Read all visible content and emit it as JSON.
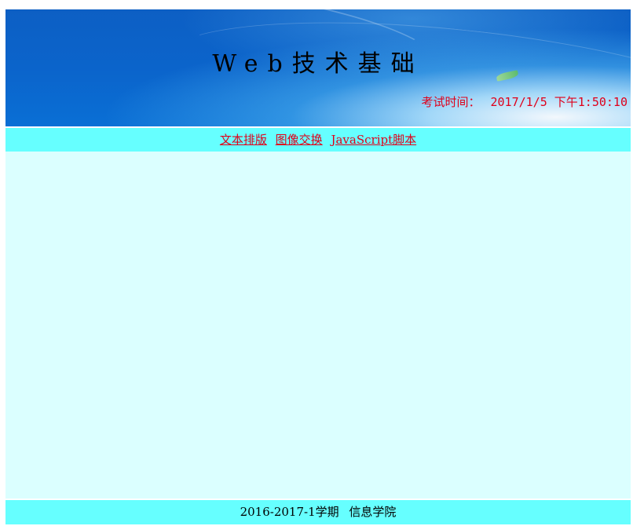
{
  "header": {
    "title": "Web技术基础",
    "exam_time_label": "考试时间：",
    "exam_time_value": "2017/1/5 下午1:50:10"
  },
  "nav": {
    "links": [
      {
        "label": "文本排版"
      },
      {
        "label": "图像交换"
      },
      {
        "label": "JavaScript脚本"
      }
    ]
  },
  "footer": {
    "term": "2016-2017-1学期",
    "department": "信息学院"
  },
  "colors": {
    "nav_background": "#66ffff",
    "content_background": "#dbffff",
    "link_color": "#e0001a"
  }
}
